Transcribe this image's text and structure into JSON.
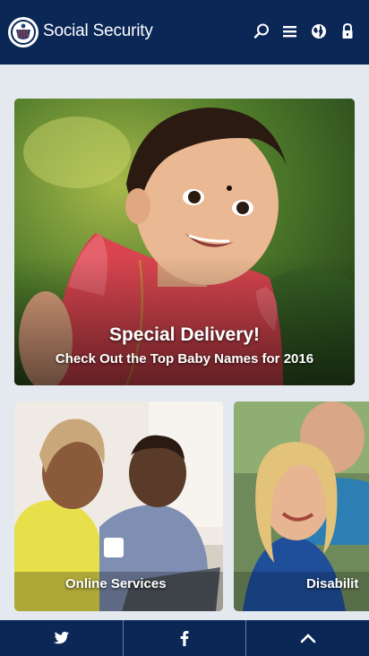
{
  "header": {
    "brand": "Social Security",
    "icons": [
      "ssa-seal-icon",
      "search-icon",
      "menu-icon",
      "globe-icon",
      "lock-icon"
    ]
  },
  "hero": {
    "title": "Special Delivery!",
    "subtitle": "Check Out the Top Baby Names for 2016"
  },
  "cards": [
    {
      "label": "Online Services"
    },
    {
      "label": "Disabilit"
    }
  ],
  "bottom_bar": {
    "icons": [
      "twitter-icon",
      "facebook-icon",
      "chevron-up-icon"
    ]
  },
  "colors": {
    "header_bg": "#0b2756",
    "page_bg": "#e4e9ef"
  }
}
